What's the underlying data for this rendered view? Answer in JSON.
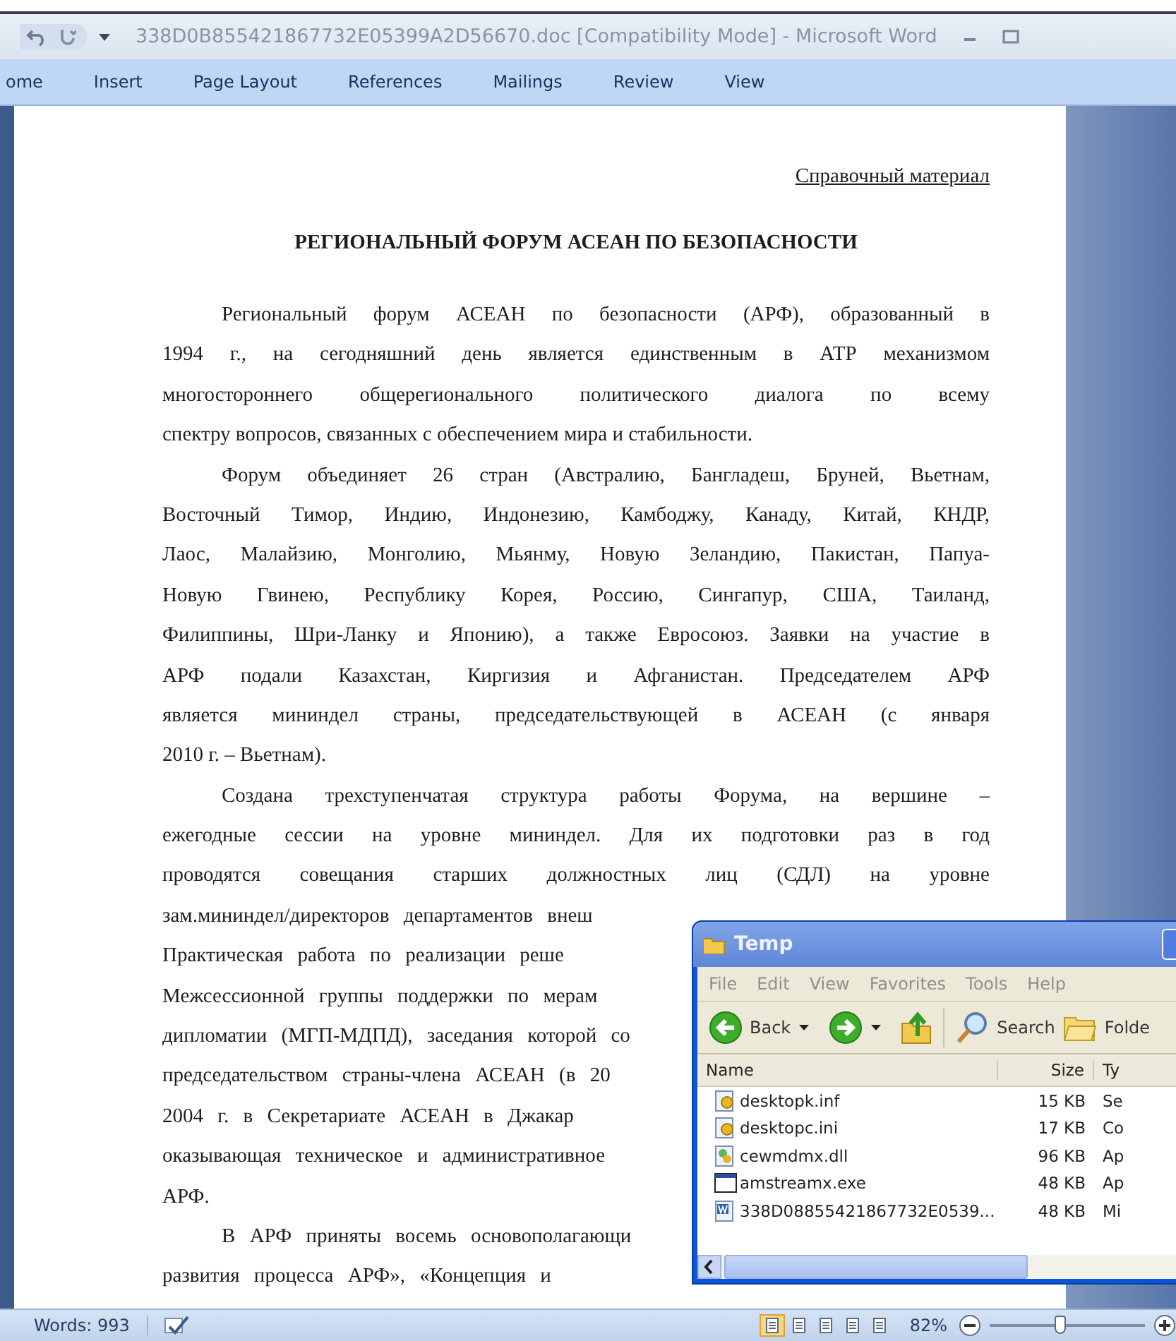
{
  "window": {
    "title": "338D0B855421867732E05399A2D56670.doc [Compatibility Mode] - Microsoft Word"
  },
  "tabs": [
    {
      "label": "ome",
      "selected": false
    },
    {
      "label": "Insert",
      "selected": false
    },
    {
      "label": "Page Layout",
      "selected": false
    },
    {
      "label": "References",
      "selected": false
    },
    {
      "label": "Mailings",
      "selected": false
    },
    {
      "label": "Review",
      "selected": false
    },
    {
      "label": "View",
      "selected": false
    }
  ],
  "document": {
    "header": "Справочный материал",
    "heading": "РЕГИОНАЛЬНЫЙ ФОРУМ АСЕАН ПО БЕЗОПАСНОСТИ",
    "lines": [
      {
        "text": "Региональный форум АСЕАН по безопасности (АРФ), образованный в",
        "kind": "first"
      },
      {
        "text": "1994 г., на сегодняшний день является единственным в АТР механизмом",
        "kind": "full"
      },
      {
        "text": "многостороннего общерегионального политического диалога по всему",
        "kind": "full"
      },
      {
        "text": "спектру вопросов, связанных с обеспечением мира и стабильности.",
        "kind": "last"
      },
      {
        "text": "Форум объединяет 26 стран (Австралию, Бангладеш, Бруней, Вьетнам,",
        "kind": "first"
      },
      {
        "text": "Восточный Тимор, Индию, Индонезию, Камбоджу, Канаду, Китай, КНДР,",
        "kind": "full"
      },
      {
        "text": "Лаос, Малайзию, Монголию, Мьянму, Новую Зеландию, Пакистан, Папуа-",
        "kind": "full"
      },
      {
        "text": "Новую Гвинею, Республику Корея, Россию, Сингапур, США, Таиланд,",
        "kind": "full"
      },
      {
        "text": "Филиппины, Шри-Ланку и Японию), а также Евросоюз. Заявки на участие в",
        "kind": "full"
      },
      {
        "text": "АРФ подали Казахстан, Киргизия и Афганистан. Председателем АРФ",
        "kind": "full"
      },
      {
        "text": "является мининдел страны, председательствующей в АСЕАН (с января",
        "kind": "full"
      },
      {
        "text": "2010 г. – Вьетнам).",
        "kind": "last"
      },
      {
        "text": "Создана трехступенчатая структура работы Форума, на вершине –",
        "kind": "first"
      },
      {
        "text": "ежегодные сессии на уровне мининдел. Для их подготовки раз в год",
        "kind": "full"
      },
      {
        "text": "проводятся совещания старших должностных лиц (СДЛ) на уровне",
        "kind": "full"
      },
      {
        "text": "зам.мининдел/директоров департаментов внеш",
        "kind": "cut"
      },
      {
        "text": "Практическая работа по реализации реше",
        "kind": "cut"
      },
      {
        "text": "Межсессионной группы поддержки по мерам",
        "kind": "cut"
      },
      {
        "text": "дипломатии (МГП-МДПД), заседания которой со",
        "kind": "cut"
      },
      {
        "text": "председательством страны-члена АСЕАН (в 20",
        "kind": "cut"
      },
      {
        "text": "2004 г. в Секретариате АСЕАН в Джакар",
        "kind": "cut"
      },
      {
        "text": "оказывающая техническое и административное",
        "kind": "cut"
      },
      {
        "text": "АРФ.",
        "kind": "last"
      },
      {
        "text": "В АРФ приняты восемь основополагающи",
        "kind": "cutfirst"
      },
      {
        "text": "развития процесса АРФ», «Концепция и",
        "kind": "cut"
      }
    ]
  },
  "explorer": {
    "title": "Temp",
    "menu": [
      "File",
      "Edit",
      "View",
      "Favorites",
      "Tools",
      "Help"
    ],
    "toolbar": {
      "back": "Back",
      "search": "Search",
      "folders": "Folde"
    },
    "columns": [
      "Name",
      "Size",
      "Ty"
    ],
    "files": [
      {
        "name": "desktopk.inf",
        "size": "15 KB",
        "type": "Se",
        "kind": "settings"
      },
      {
        "name": "desktopc.ini",
        "size": "17 KB",
        "type": "Co",
        "kind": "settings"
      },
      {
        "name": "cewmdmx.dll",
        "size": "96 KB",
        "type": "Ap",
        "kind": "library"
      },
      {
        "name": "amstreamx.exe",
        "size": "48 KB",
        "type": "Ap",
        "kind": "program"
      },
      {
        "name": "338D08855421867732E0539...",
        "size": "48 KB",
        "type": "Mi",
        "kind": "document"
      }
    ]
  },
  "status_bar": {
    "words": "Words: 993",
    "views": [
      {
        "selected": true
      },
      {
        "selected": false
      },
      {
        "selected": false
      },
      {
        "selected": false
      },
      {
        "selected": false
      }
    ],
    "zoom": "82%",
    "zoom_slider": {
      "level": 0.45
    }
  }
}
